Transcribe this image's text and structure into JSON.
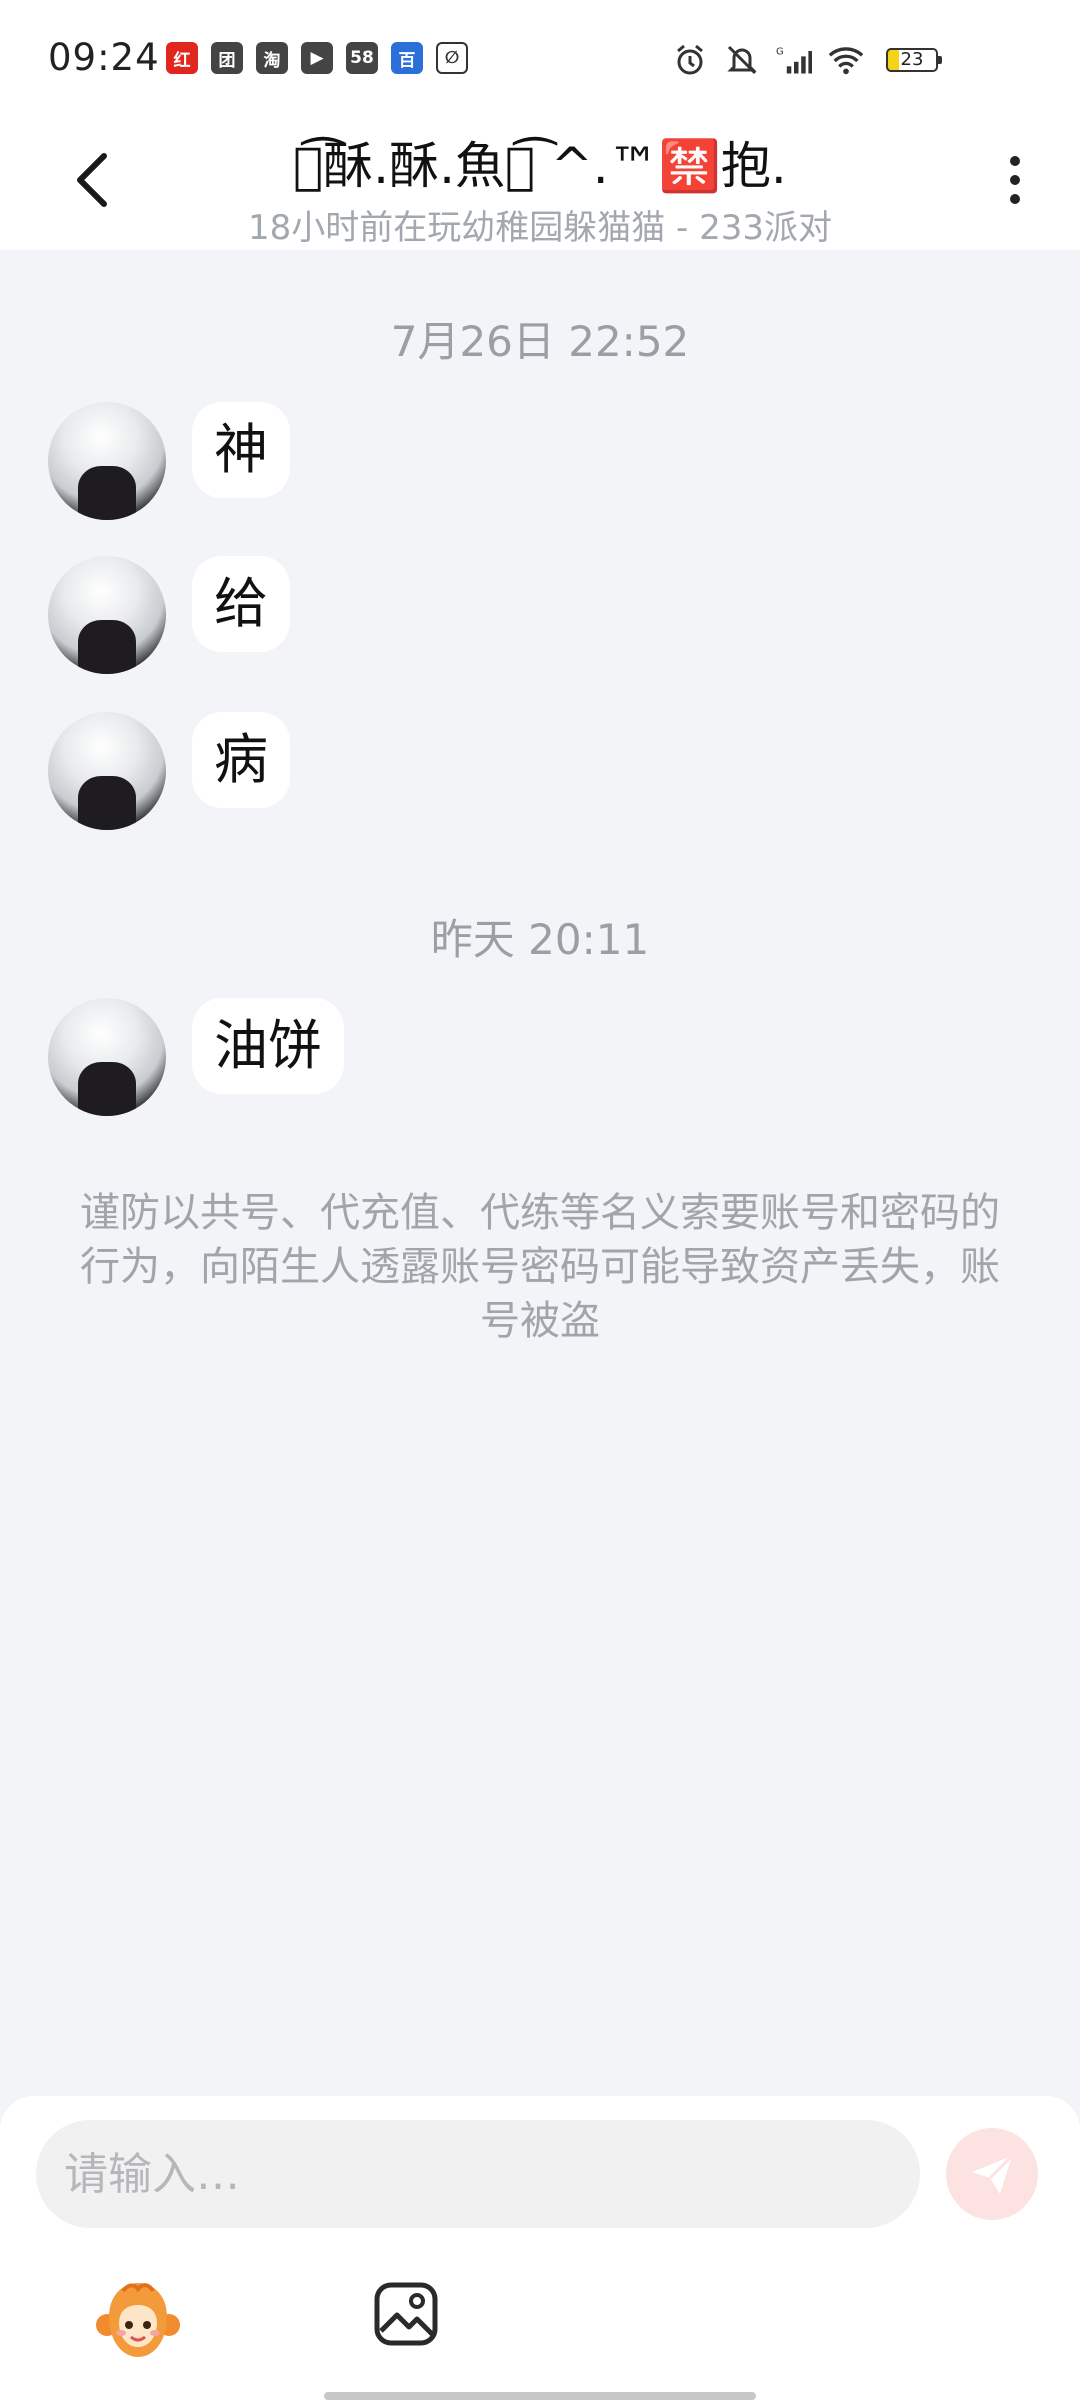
{
  "status_bar": {
    "time": "09:24",
    "apps": [
      "红",
      "团",
      "淘",
      "▶",
      "58",
      "百",
      "∅"
    ],
    "battery": "23",
    "signal_label": "G"
  },
  "header": {
    "title": "ㄣ͡酥.酥.魚ぎ͡ ^.™🈲抱.",
    "subtitle": "18小时前在玩幼稚园躲猫猫 - 233派对"
  },
  "chat": {
    "groups": [
      {
        "timestamp": "7月26日  22:52",
        "messages": [
          "神",
          "给",
          "病"
        ]
      },
      {
        "timestamp": "昨天  20:11",
        "messages": [
          "油饼"
        ]
      }
    ],
    "notice": "谨防以共号、代充值、代练等名义索要账号和密码的行为，向陌生人透露账号密码可能导致资产丢失，账号被盗"
  },
  "input": {
    "placeholder": "请输入…"
  },
  "colors": {
    "background": "#f2f4f7",
    "bubble": "#ffffff",
    "send_button": "#fde2e2",
    "muted_text": "#9b9fa5"
  }
}
